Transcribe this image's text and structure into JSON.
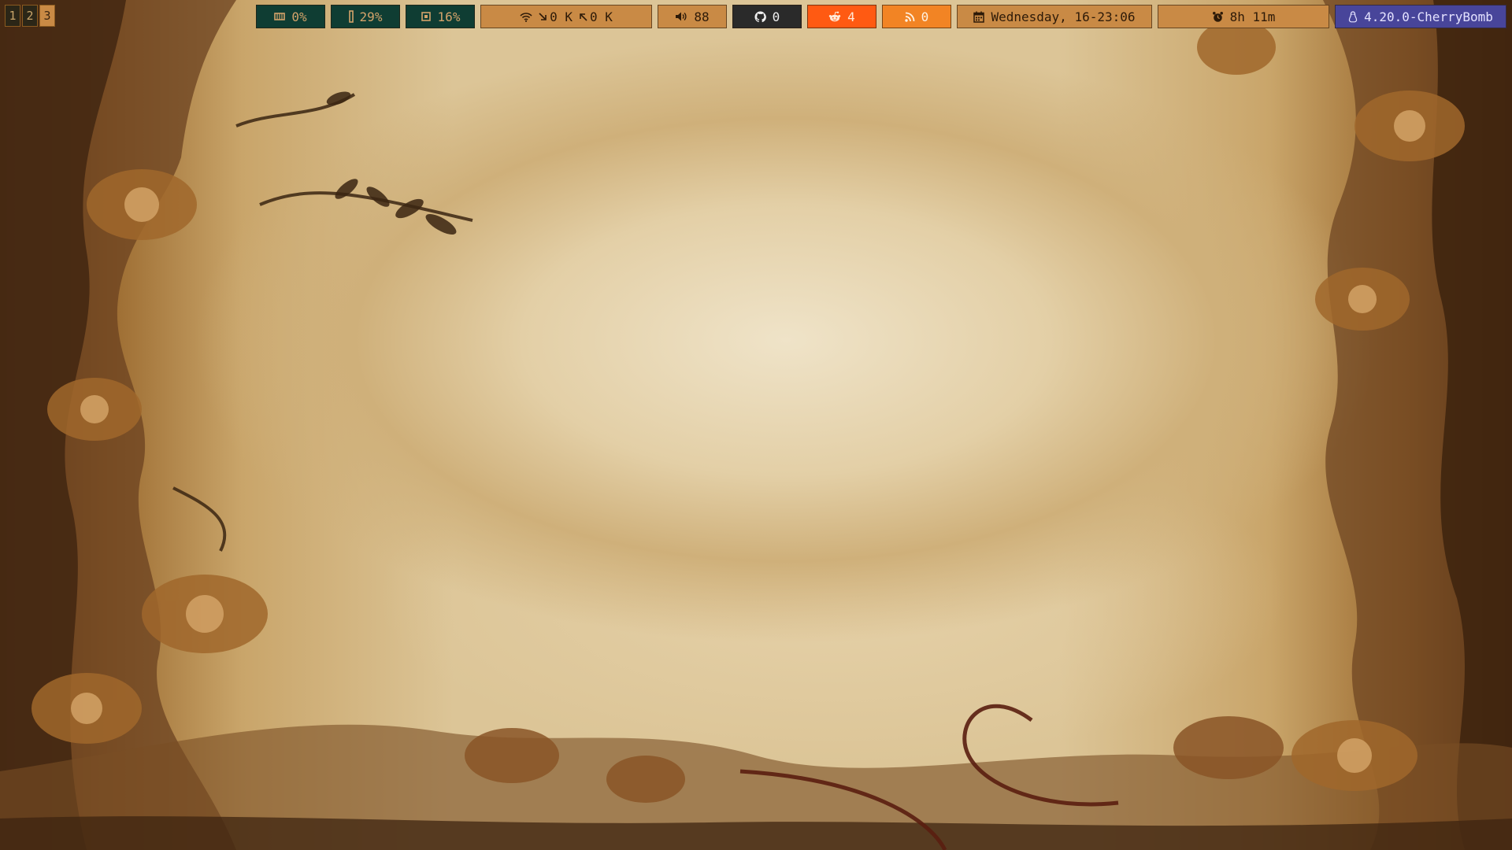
{
  "workspaces": [
    "1",
    "2",
    "3"
  ],
  "modules": {
    "storage": {
      "icon": "hard-disk-icon",
      "value": "0%"
    },
    "memory": {
      "icon": "memory-icon",
      "value": "29%"
    },
    "cpu": {
      "icon": "cpu-icon",
      "value": "16%"
    },
    "network": {
      "icon": "wifi-icon",
      "down_icon": "arrow-down-icon",
      "down": "0 K",
      "up_icon": "arrow-up-icon",
      "up": "0 K"
    },
    "volume": {
      "icon": "speaker-icon",
      "value": "88"
    },
    "github": {
      "icon": "github-icon",
      "value": "0"
    },
    "reddit": {
      "icon": "reddit-icon",
      "value": "4"
    },
    "rss": {
      "icon": "rss-icon",
      "value": "0"
    },
    "clock": {
      "icon": "calendar-icon",
      "value": "Wednesday, 16-23:06"
    },
    "uptime": {
      "icon": "alarm-clock-icon",
      "value": "8h 11m"
    },
    "kernel": {
      "icon": "linux-icon",
      "value": "4.20.0-CherryBomb"
    }
  },
  "colors": {
    "dark_module": "#0f3d33",
    "orange_module": "#c98a45",
    "github_module": "#2a2a2a",
    "reddit_module": "#ff5a12",
    "rss_module": "#f28424",
    "kernel_module": "#48459a"
  }
}
